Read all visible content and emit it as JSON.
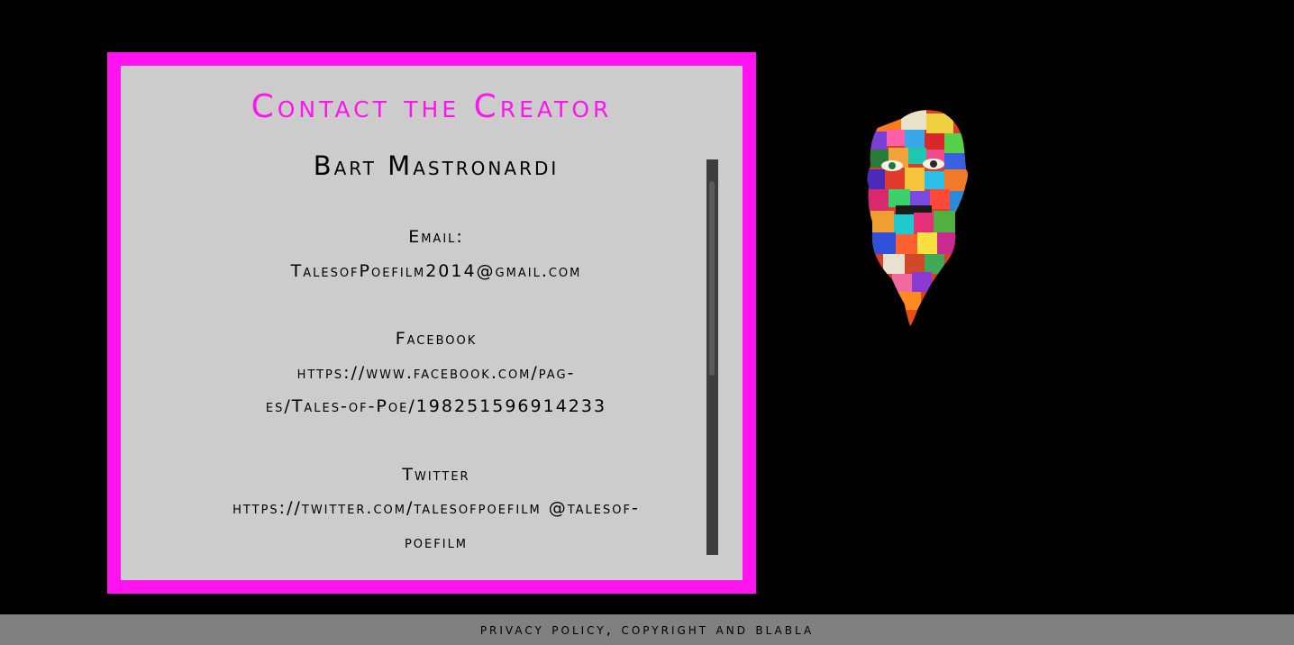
{
  "contact_card": {
    "title": "Contact the Creator",
    "creator_name": "Bart Mastronardi",
    "email": {
      "label": "Email:",
      "value": "TalesofPoefilm2014@gmail.com"
    },
    "facebook": {
      "label": "Facebook",
      "value_line1": "https://www.facebook.com/pag-",
      "value_line2": "es/Tales-of-Poe/198251596914233"
    },
    "twitter": {
      "label": "Twitter",
      "value_line1": "https://twitter.com/talesofpoefilm @talesof-",
      "value_line2": "poefilm"
    }
  },
  "footer": {
    "text": "privacy policy, copyright and blabla"
  },
  "icons": {
    "expand": "expand-plus-icon",
    "portrait": "poe-portrait-image"
  },
  "colors": {
    "accent": "#ff14f0",
    "card_background": "#cccccc",
    "page_background": "#000000",
    "footer_background": "#808080",
    "scrollbar_track": "#3d3d3d"
  }
}
